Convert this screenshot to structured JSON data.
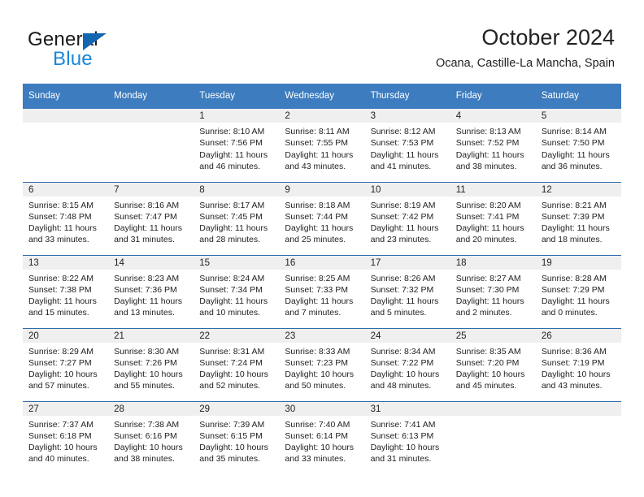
{
  "brand": {
    "name_top": "General",
    "name_bottom": "Blue",
    "triangle_color": "#1566b0",
    "blue_text_color": "#1a86d8"
  },
  "header": {
    "title": "October 2024",
    "subtitle": "Ocana, Castille-La Mancha, Spain"
  },
  "colors": {
    "header_row": "#3c7cbf",
    "week_divider": "#2f6cab",
    "daynum_band": "#efefef",
    "text": "#222222"
  },
  "weekday_headers": [
    "Sunday",
    "Monday",
    "Tuesday",
    "Wednesday",
    "Thursday",
    "Friday",
    "Saturday"
  ],
  "labels": {
    "sunrise_prefix": "Sunrise:",
    "sunset_prefix": "Sunset:",
    "daylight_prefix": "Daylight:"
  },
  "weeks": [
    [
      {
        "day": "",
        "sunrise": "",
        "sunset": "",
        "daylight": "",
        "empty": true
      },
      {
        "day": "",
        "sunrise": "",
        "sunset": "",
        "daylight": "",
        "empty": true
      },
      {
        "day": "1",
        "sunrise": "Sunrise: 8:10 AM",
        "sunset": "Sunset: 7:56 PM",
        "daylight": "Daylight: 11 hours\nand 46 minutes."
      },
      {
        "day": "2",
        "sunrise": "Sunrise: 8:11 AM",
        "sunset": "Sunset: 7:55 PM",
        "daylight": "Daylight: 11 hours\nand 43 minutes."
      },
      {
        "day": "3",
        "sunrise": "Sunrise: 8:12 AM",
        "sunset": "Sunset: 7:53 PM",
        "daylight": "Daylight: 11 hours\nand 41 minutes."
      },
      {
        "day": "4",
        "sunrise": "Sunrise: 8:13 AM",
        "sunset": "Sunset: 7:52 PM",
        "daylight": "Daylight: 11 hours\nand 38 minutes."
      },
      {
        "day": "5",
        "sunrise": "Sunrise: 8:14 AM",
        "sunset": "Sunset: 7:50 PM",
        "daylight": "Daylight: 11 hours\nand 36 minutes."
      }
    ],
    [
      {
        "day": "6",
        "sunrise": "Sunrise: 8:15 AM",
        "sunset": "Sunset: 7:48 PM",
        "daylight": "Daylight: 11 hours\nand 33 minutes."
      },
      {
        "day": "7",
        "sunrise": "Sunrise: 8:16 AM",
        "sunset": "Sunset: 7:47 PM",
        "daylight": "Daylight: 11 hours\nand 31 minutes."
      },
      {
        "day": "8",
        "sunrise": "Sunrise: 8:17 AM",
        "sunset": "Sunset: 7:45 PM",
        "daylight": "Daylight: 11 hours\nand 28 minutes."
      },
      {
        "day": "9",
        "sunrise": "Sunrise: 8:18 AM",
        "sunset": "Sunset: 7:44 PM",
        "daylight": "Daylight: 11 hours\nand 25 minutes."
      },
      {
        "day": "10",
        "sunrise": "Sunrise: 8:19 AM",
        "sunset": "Sunset: 7:42 PM",
        "daylight": "Daylight: 11 hours\nand 23 minutes."
      },
      {
        "day": "11",
        "sunrise": "Sunrise: 8:20 AM",
        "sunset": "Sunset: 7:41 PM",
        "daylight": "Daylight: 11 hours\nand 20 minutes."
      },
      {
        "day": "12",
        "sunrise": "Sunrise: 8:21 AM",
        "sunset": "Sunset: 7:39 PM",
        "daylight": "Daylight: 11 hours\nand 18 minutes."
      }
    ],
    [
      {
        "day": "13",
        "sunrise": "Sunrise: 8:22 AM",
        "sunset": "Sunset: 7:38 PM",
        "daylight": "Daylight: 11 hours\nand 15 minutes."
      },
      {
        "day": "14",
        "sunrise": "Sunrise: 8:23 AM",
        "sunset": "Sunset: 7:36 PM",
        "daylight": "Daylight: 11 hours\nand 13 minutes."
      },
      {
        "day": "15",
        "sunrise": "Sunrise: 8:24 AM",
        "sunset": "Sunset: 7:34 PM",
        "daylight": "Daylight: 11 hours\nand 10 minutes."
      },
      {
        "day": "16",
        "sunrise": "Sunrise: 8:25 AM",
        "sunset": "Sunset: 7:33 PM",
        "daylight": "Daylight: 11 hours\nand 7 minutes."
      },
      {
        "day": "17",
        "sunrise": "Sunrise: 8:26 AM",
        "sunset": "Sunset: 7:32 PM",
        "daylight": "Daylight: 11 hours\nand 5 minutes."
      },
      {
        "day": "18",
        "sunrise": "Sunrise: 8:27 AM",
        "sunset": "Sunset: 7:30 PM",
        "daylight": "Daylight: 11 hours\nand 2 minutes."
      },
      {
        "day": "19",
        "sunrise": "Sunrise: 8:28 AM",
        "sunset": "Sunset: 7:29 PM",
        "daylight": "Daylight: 11 hours\nand 0 minutes."
      }
    ],
    [
      {
        "day": "20",
        "sunrise": "Sunrise: 8:29 AM",
        "sunset": "Sunset: 7:27 PM",
        "daylight": "Daylight: 10 hours\nand 57 minutes."
      },
      {
        "day": "21",
        "sunrise": "Sunrise: 8:30 AM",
        "sunset": "Sunset: 7:26 PM",
        "daylight": "Daylight: 10 hours\nand 55 minutes."
      },
      {
        "day": "22",
        "sunrise": "Sunrise: 8:31 AM",
        "sunset": "Sunset: 7:24 PM",
        "daylight": "Daylight: 10 hours\nand 52 minutes."
      },
      {
        "day": "23",
        "sunrise": "Sunrise: 8:33 AM",
        "sunset": "Sunset: 7:23 PM",
        "daylight": "Daylight: 10 hours\nand 50 minutes."
      },
      {
        "day": "24",
        "sunrise": "Sunrise: 8:34 AM",
        "sunset": "Sunset: 7:22 PM",
        "daylight": "Daylight: 10 hours\nand 48 minutes."
      },
      {
        "day": "25",
        "sunrise": "Sunrise: 8:35 AM",
        "sunset": "Sunset: 7:20 PM",
        "daylight": "Daylight: 10 hours\nand 45 minutes."
      },
      {
        "day": "26",
        "sunrise": "Sunrise: 8:36 AM",
        "sunset": "Sunset: 7:19 PM",
        "daylight": "Daylight: 10 hours\nand 43 minutes."
      }
    ],
    [
      {
        "day": "27",
        "sunrise": "Sunrise: 7:37 AM",
        "sunset": "Sunset: 6:18 PM",
        "daylight": "Daylight: 10 hours\nand 40 minutes."
      },
      {
        "day": "28",
        "sunrise": "Sunrise: 7:38 AM",
        "sunset": "Sunset: 6:16 PM",
        "daylight": "Daylight: 10 hours\nand 38 minutes."
      },
      {
        "day": "29",
        "sunrise": "Sunrise: 7:39 AM",
        "sunset": "Sunset: 6:15 PM",
        "daylight": "Daylight: 10 hours\nand 35 minutes."
      },
      {
        "day": "30",
        "sunrise": "Sunrise: 7:40 AM",
        "sunset": "Sunset: 6:14 PM",
        "daylight": "Daylight: 10 hours\nand 33 minutes."
      },
      {
        "day": "31",
        "sunrise": "Sunrise: 7:41 AM",
        "sunset": "Sunset: 6:13 PM",
        "daylight": "Daylight: 10 hours\nand 31 minutes."
      },
      {
        "day": "",
        "sunrise": "",
        "sunset": "",
        "daylight": "",
        "empty": true
      },
      {
        "day": "",
        "sunrise": "",
        "sunset": "",
        "daylight": "",
        "empty": true
      }
    ]
  ]
}
